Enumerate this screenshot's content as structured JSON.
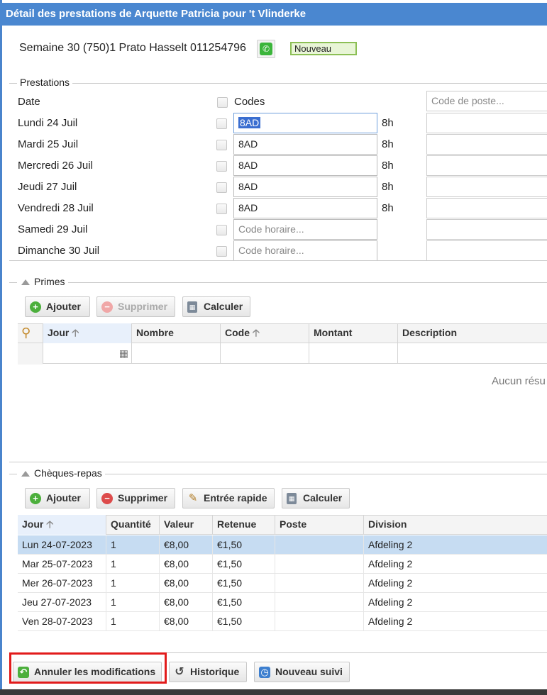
{
  "window": {
    "title": "Détail des prestations de Arquette Patricia pour 't Vlinderke"
  },
  "header": {
    "week_info": "Semaine 30 (750)1 Prato Hasselt  011254796",
    "phone_icon": "phone-icon",
    "status": "Nouveau"
  },
  "prestations": {
    "legend": "Prestations",
    "date_header": "Date",
    "codes_header": "Codes",
    "poste_placeholder": "Code de poste...",
    "code_placeholder": "Code horaire...",
    "days": [
      {
        "label": "Lundi 24 Juil",
        "code": "8AD",
        "hours": "8h"
      },
      {
        "label": "Mardi 25 Juil",
        "code": "8AD",
        "hours": "8h"
      },
      {
        "label": "Mercredi 26 Juil",
        "code": "8AD",
        "hours": "8h"
      },
      {
        "label": "Jeudi 27 Juil",
        "code": "8AD",
        "hours": "8h"
      },
      {
        "label": "Vendredi 28 Juil",
        "code": "8AD",
        "hours": "8h"
      },
      {
        "label": "Samedi 29 Juil",
        "code": "",
        "hours": ""
      },
      {
        "label": "Dimanche 30 Juil",
        "code": "",
        "hours": ""
      }
    ]
  },
  "primes": {
    "legend": "Primes",
    "buttons": {
      "add": "Ajouter",
      "delete": "Supprimer",
      "calculate": "Calculer"
    },
    "columns": [
      "Jour",
      "Nombre",
      "Code",
      "Montant",
      "Description"
    ],
    "empty_text": "Aucun résu"
  },
  "cheques": {
    "legend": "Chèques-repas",
    "buttons": {
      "add": "Ajouter",
      "delete": "Supprimer",
      "quick": "Entrée rapide",
      "calculate": "Calculer"
    },
    "columns": [
      "Jour",
      "Quantité",
      "Valeur",
      "Retenue",
      "Poste",
      "Division"
    ],
    "rows": [
      {
        "jour": "Lun 24-07-2023",
        "quantite": "1",
        "valeur": "€8,00",
        "retenue": "€1,50",
        "poste": "",
        "division": "Afdeling 2"
      },
      {
        "jour": "Mar 25-07-2023",
        "quantite": "1",
        "valeur": "€8,00",
        "retenue": "€1,50",
        "poste": "",
        "division": "Afdeling 2"
      },
      {
        "jour": "Mer 26-07-2023",
        "quantite": "1",
        "valeur": "€8,00",
        "retenue": "€1,50",
        "poste": "",
        "division": "Afdeling 2"
      },
      {
        "jour": "Jeu 27-07-2023",
        "quantite": "1",
        "valeur": "€8,00",
        "retenue": "€1,50",
        "poste": "",
        "division": "Afdeling 2"
      },
      {
        "jour": "Ven 28-07-2023",
        "quantite": "1",
        "valeur": "€8,00",
        "retenue": "€1,50",
        "poste": "",
        "division": "Afdeling 2"
      }
    ]
  },
  "footer": {
    "cancel": "Annuler les modifications",
    "history": "Historique",
    "new_followup": "Nouveau suivi"
  },
  "colors": {
    "title_bar": "#4a87d0",
    "highlight": "#e21b1b",
    "selected_row": "#c6dcf2"
  }
}
